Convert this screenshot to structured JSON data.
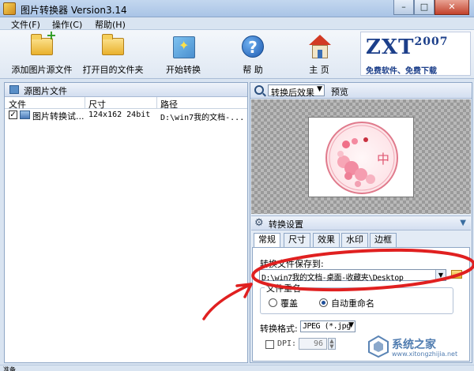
{
  "window": {
    "title": "图片转换器 Version3.14",
    "controls": {
      "minimize": "–",
      "maximize": "□",
      "close": "✕"
    }
  },
  "menu": [
    "文件(F)",
    "操作(C)",
    "帮助(H)"
  ],
  "toolbar": {
    "items": [
      {
        "label": "添加图片源文件",
        "icon": "folder-add-icon"
      },
      {
        "label": "打开目的文件夹",
        "icon": "folder-icon"
      },
      {
        "label": "开始转换",
        "icon": "magic-wand-icon"
      },
      {
        "label": "帮 助",
        "icon": "help-icon"
      },
      {
        "label": "主 页",
        "icon": "home-icon"
      }
    ],
    "banner": {
      "logo": "ZXT",
      "year": "2007",
      "slogan": "免费软件、免费下载"
    }
  },
  "source_panel": {
    "title": "源图片文件",
    "columns": [
      "文件",
      "尺寸",
      "路径"
    ],
    "files": [
      {
        "checked": true,
        "name": "图片转换试...",
        "size": "124x162  24bit",
        "path": "D:\\win7我的文档-..."
      }
    ]
  },
  "preview": {
    "view_option": "转换后效果",
    "label": "预览",
    "image_char": "中"
  },
  "settings": {
    "title": "转换设置",
    "tabs": [
      "常规",
      "尺寸",
      "效果",
      "水印",
      "边框"
    ],
    "active_tab": "常规",
    "save_to_label": "转换文件保存到:",
    "save_path": "D:\\win7我的文档-桌面-收藏夹\\Desktop",
    "rename": {
      "title": "文件重名",
      "options": [
        "覆盖",
        "自动重命名"
      ],
      "selected": "自动重命名"
    },
    "format_label": "转换格式:",
    "format_value": "JPEG (*.jpg",
    "dpi_label": "DPI:",
    "dpi_value": "96",
    "dpi_enabled": false
  },
  "status": {
    "text": "准备"
  },
  "watermark": {
    "text": "系统之家",
    "url": "www.xitongzhijia.net"
  },
  "colors": {
    "annotation": "#e02020",
    "accent": "#1c3f8a"
  }
}
